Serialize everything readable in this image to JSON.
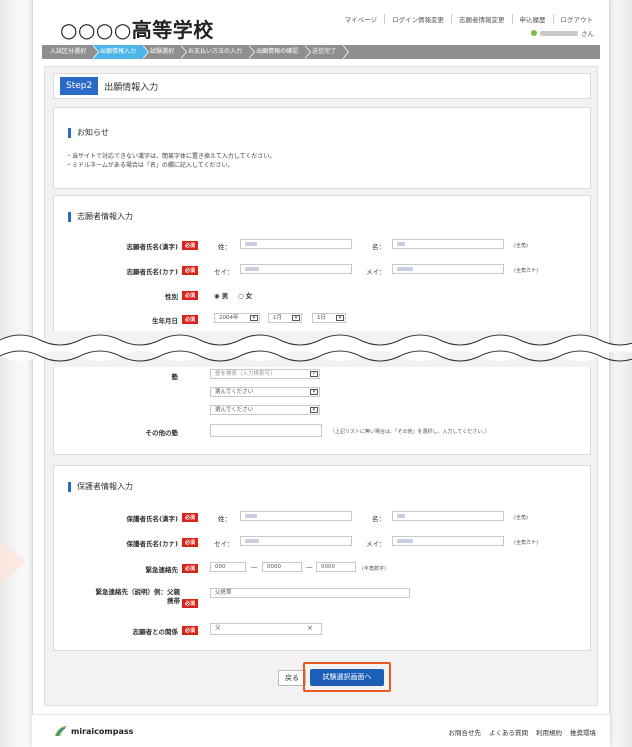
{
  "header": {
    "school_name": "○○○○高等学校",
    "nav": [
      "マイページ",
      "ログイン情報変更",
      "志願者情報変更",
      "申込履歴",
      "ログアウト"
    ],
    "user_suffix": "さん"
  },
  "steps": [
    "入試区分選択",
    "出願情報入力",
    "試験選択",
    "お支払い方法の入力",
    "出願情報の確認",
    "送信完了"
  ],
  "step_header": {
    "badge": "Step2",
    "title": "出願情報入力"
  },
  "notice": {
    "title": "お知らせ",
    "lines": [
      "・当サイトで対応できない漢字は、簡易字体に置き換えて入力してください。",
      "・ミドルネームがある場合は「名」の欄に記入してください。"
    ]
  },
  "applicant": {
    "title": "志願者情報入力",
    "name_kanji_label": "志願者氏名(漢字)",
    "name_kana_label": "志願者氏名(カナ)",
    "gender_label": "性別",
    "birth_label": "生年月日",
    "sei": "姓：",
    "mei": "名：",
    "sei_kana": "セイ：",
    "mei_kana": "メイ：",
    "zenkaku": "(全角)",
    "zenkaku_kana": "(全角カナ)",
    "male": "男",
    "female": "女",
    "birth_year": "2004年",
    "birth_month": "1月",
    "birth_day": "1日",
    "required": "必須"
  },
  "juku": {
    "label": "塾",
    "search_placeholder": "塾を検索（入力検索可）",
    "select1": "選んでください",
    "select2": "選んでください",
    "other_label": "その他の塾",
    "other_hint": "（上記リストに無い場合は、「その他」を選択し、入力してください。）"
  },
  "guardian": {
    "title": "保護者情報入力",
    "name_kanji_label": "保護者氏名(漢字)",
    "name_kana_label": "保護者氏名(カナ)",
    "emergency_label": "緊急連絡先",
    "tel1": "000",
    "tel2": "0000",
    "tel3": "0000",
    "half": "(半角数字)",
    "emergency_desc_label": "緊急連絡先（説明）例：父親携帯",
    "emergency_desc_value": "父携帯",
    "relation_label": "志願者との関係",
    "relation_value": "父",
    "sei": "姓：",
    "mei": "名：",
    "sei_kana": "セイ：",
    "mei_kana": "メイ：",
    "zenkaku": "(全角)",
    "zenkaku_kana": "(全角カナ)",
    "required": "必須"
  },
  "buttons": {
    "back": "戻る",
    "next": "試験選択画面へ"
  },
  "footer": {
    "logo": "miraicompass",
    "links": [
      "お問合せ先",
      "よくある質問",
      "利用規約",
      "推奨環境"
    ]
  }
}
